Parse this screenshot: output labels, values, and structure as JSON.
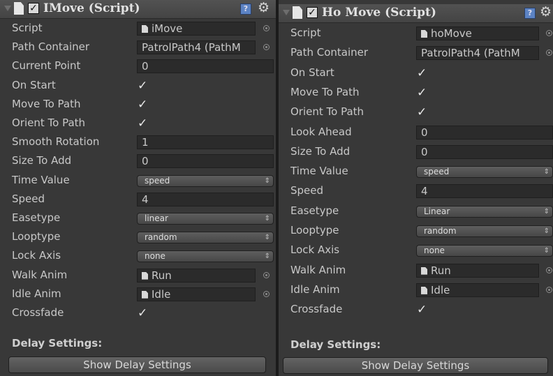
{
  "left": {
    "title": "IMove (Script)",
    "rows": [
      {
        "label": "Script",
        "kind": "object",
        "value": "iMove"
      },
      {
        "label": "Path Container",
        "kind": "text_pick",
        "value": "PatrolPath4 (PathM"
      },
      {
        "label": "Current Point",
        "kind": "text",
        "value": "0"
      },
      {
        "label": "On Start",
        "kind": "check",
        "checked": true
      },
      {
        "label": "Move To Path",
        "kind": "check",
        "checked": true
      },
      {
        "label": "Orient To Path",
        "kind": "check",
        "checked": true
      },
      {
        "label": "Smooth Rotation",
        "kind": "text",
        "value": "1"
      },
      {
        "label": "Size To Add",
        "kind": "text",
        "value": "0"
      },
      {
        "label": "Time Value",
        "kind": "dropdown",
        "value": "speed"
      },
      {
        "label": "Speed",
        "kind": "text",
        "value": "4"
      },
      {
        "label": "Easetype",
        "kind": "dropdown",
        "value": "linear"
      },
      {
        "label": "Looptype",
        "kind": "dropdown",
        "value": "random"
      },
      {
        "label": "Lock Axis",
        "kind": "dropdown",
        "value": "none"
      },
      {
        "label": "Walk Anim",
        "kind": "object",
        "value": "Run"
      },
      {
        "label": "Idle Anim",
        "kind": "object",
        "value": "Idle"
      },
      {
        "label": "Crossfade",
        "kind": "check",
        "checked": true
      }
    ],
    "section": "Delay Settings:",
    "button": "Show Delay Settings"
  },
  "right": {
    "title": "Ho Move (Script)",
    "rows": [
      {
        "label": "Script",
        "kind": "object",
        "value": "hoMove"
      },
      {
        "label": "Path Container",
        "kind": "text_pick",
        "value": "PatrolPath4 (PathM"
      },
      {
        "label": "On Start",
        "kind": "check",
        "checked": true
      },
      {
        "label": "Move To Path",
        "kind": "check",
        "checked": true
      },
      {
        "label": "Orient To Path",
        "kind": "check",
        "checked": true
      },
      {
        "label": "Look Ahead",
        "kind": "text",
        "value": "0"
      },
      {
        "label": "Size To Add",
        "kind": "text",
        "value": "0"
      },
      {
        "label": "Time Value",
        "kind": "dropdown",
        "value": "speed"
      },
      {
        "label": "Speed",
        "kind": "text",
        "value": "4"
      },
      {
        "label": "Easetype",
        "kind": "dropdown",
        "value": "Linear"
      },
      {
        "label": "Looptype",
        "kind": "dropdown",
        "value": "random"
      },
      {
        "label": "Lock Axis",
        "kind": "dropdown",
        "value": "none"
      },
      {
        "label": "Walk Anim",
        "kind": "object",
        "value": "Run"
      },
      {
        "label": "Idle Anim",
        "kind": "object",
        "value": "Idle"
      },
      {
        "label": "Crossfade",
        "kind": "check",
        "checked": true
      }
    ],
    "section": "Delay Settings:",
    "button": "Show Delay Settings"
  },
  "icons": {
    "header_fold": "foldout-triangle-icon",
    "header_doc": "script-file-icon",
    "help": "help-book-icon",
    "gear": "gear-icon",
    "object": "script-file-icon",
    "pick": "object-picker-icon"
  }
}
